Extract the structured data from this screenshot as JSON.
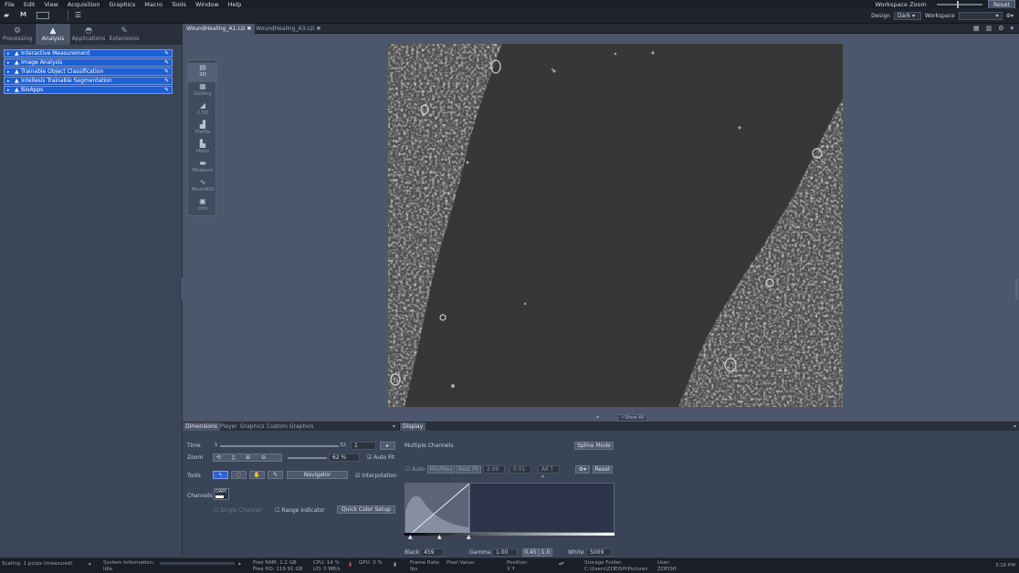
{
  "menu": [
    "File",
    "Edit",
    "View",
    "Acquisition",
    "Graphics",
    "Macro",
    "Tools",
    "Window",
    "Help"
  ],
  "window": {
    "zoom_label": "Workspace Zoom",
    "reset_label": "Reset"
  },
  "toolbar": {
    "design_label": "Design",
    "design_value": "Dark",
    "workspace_label": "Workspace",
    "workspace_value": ""
  },
  "left_tabs": [
    {
      "label": "Processing",
      "icon": "gears-icon"
    },
    {
      "label": "Analysis",
      "icon": "analysis-icon"
    },
    {
      "label": "Applications",
      "icon": "applications-icon"
    },
    {
      "label": "Extensions",
      "icon": "extensions-icon"
    }
  ],
  "tools": [
    "Interactive Measurement",
    "Image Analysis",
    "Trainable Object Classification",
    "Intellesis Trainable Segmentation",
    "BioApps"
  ],
  "doc_tabs": [
    "WoundHealing_A1.czi",
    "WoundHealing_A3.czi"
  ],
  "view_tools": [
    "2D",
    "Gallery",
    "2.5D",
    "Profile",
    "Histo",
    "Measure",
    "MeanROI",
    "Info"
  ],
  "view": {
    "show_all": "Show All"
  },
  "bottom_tabs": [
    "Dimensions",
    "Player",
    "Graphics",
    "Custom Graphics"
  ],
  "dimensions": {
    "time_label": "Time",
    "time_start": "1",
    "time_end": "32",
    "time_value": "1",
    "zoom_label": "Zoom",
    "zoom_value": "62 %",
    "autofit_label": "Auto Fit",
    "tools_label": "Tools",
    "navigator_label": "Navigator",
    "interpolation_label": "Interpolation",
    "channels_label": "Channels",
    "channel_name": "DAPI",
    "single_channel_label": "Single Channel",
    "range_indicator_label": "Range Indicator",
    "quick_color_label": "Quick Color Setup"
  },
  "display": {
    "tab_label": "Display",
    "multiple_channels": "Multiple Channels",
    "spline_mode": "Spline Mode",
    "auto_label": "Auto",
    "minmax_label": "Min/Max",
    "bestfit_label": "Best Fit",
    "bestfit_value": "2.00",
    "pct_value": "0.01",
    "all_label": "All T",
    "reset_label": "Reset",
    "black_label": "Black",
    "black_value": "459",
    "gamma_label": "Gamma",
    "gamma_value": "1.00",
    "gamma_a": "0.45",
    "gamma_b": "1.0",
    "white_label": "White",
    "white_value": "5009"
  },
  "status": {
    "scaling": "Scaling: 1 px/px (measured)",
    "system_info": "System Information:",
    "system_state": "Idle",
    "free_ram": "Free RAM: 1.2 GB",
    "free_hd": "Free HD: 119.91 GB",
    "cpu": "CPU: 14 %",
    "io": "I/O: 0 MB/s",
    "gpu": "GPU: 0 %",
    "frame_rate": "Frame Rate:",
    "frame_rate_unit": "fps",
    "pixel_value": "Pixel Value:",
    "position": "Position:",
    "position_xy": "X   Y",
    "storage_label": "Storage Folder:",
    "storage_path": "C:\\Users\\ZOEISH\\Pictures",
    "user_label": "User:",
    "user_value": "ZOEISH",
    "time": "3:16 PM"
  }
}
